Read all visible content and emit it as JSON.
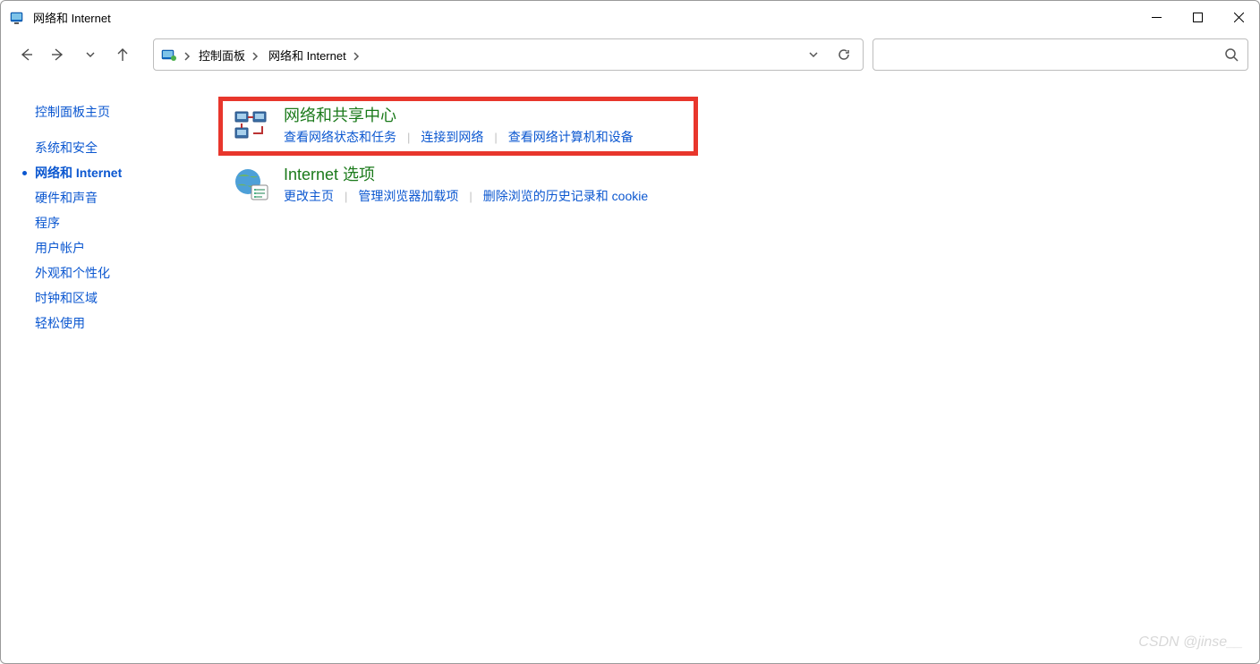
{
  "window": {
    "title": "网络和 Internet"
  },
  "breadcrumb": {
    "segments": [
      "控制面板",
      "网络和 Internet"
    ]
  },
  "search": {
    "placeholder": ""
  },
  "sidebar": {
    "items": [
      {
        "label": "控制面板主页",
        "active": false
      },
      {
        "label": "系统和安全",
        "active": false
      },
      {
        "label": "网络和 Internet",
        "active": true
      },
      {
        "label": "硬件和声音",
        "active": false
      },
      {
        "label": "程序",
        "active": false
      },
      {
        "label": "用户帐户",
        "active": false
      },
      {
        "label": "外观和个性化",
        "active": false
      },
      {
        "label": "时钟和区域",
        "active": false
      },
      {
        "label": "轻松使用",
        "active": false
      }
    ]
  },
  "main": {
    "categories": [
      {
        "title": "网络和共享中心",
        "highlight": true,
        "links": [
          "查看网络状态和任务",
          "连接到网络",
          "查看网络计算机和设备"
        ]
      },
      {
        "title": "Internet 选项",
        "highlight": false,
        "links": [
          "更改主页",
          "管理浏览器加载项",
          "删除浏览的历史记录和 cookie"
        ]
      }
    ]
  },
  "watermark": "CSDN @jinse__"
}
